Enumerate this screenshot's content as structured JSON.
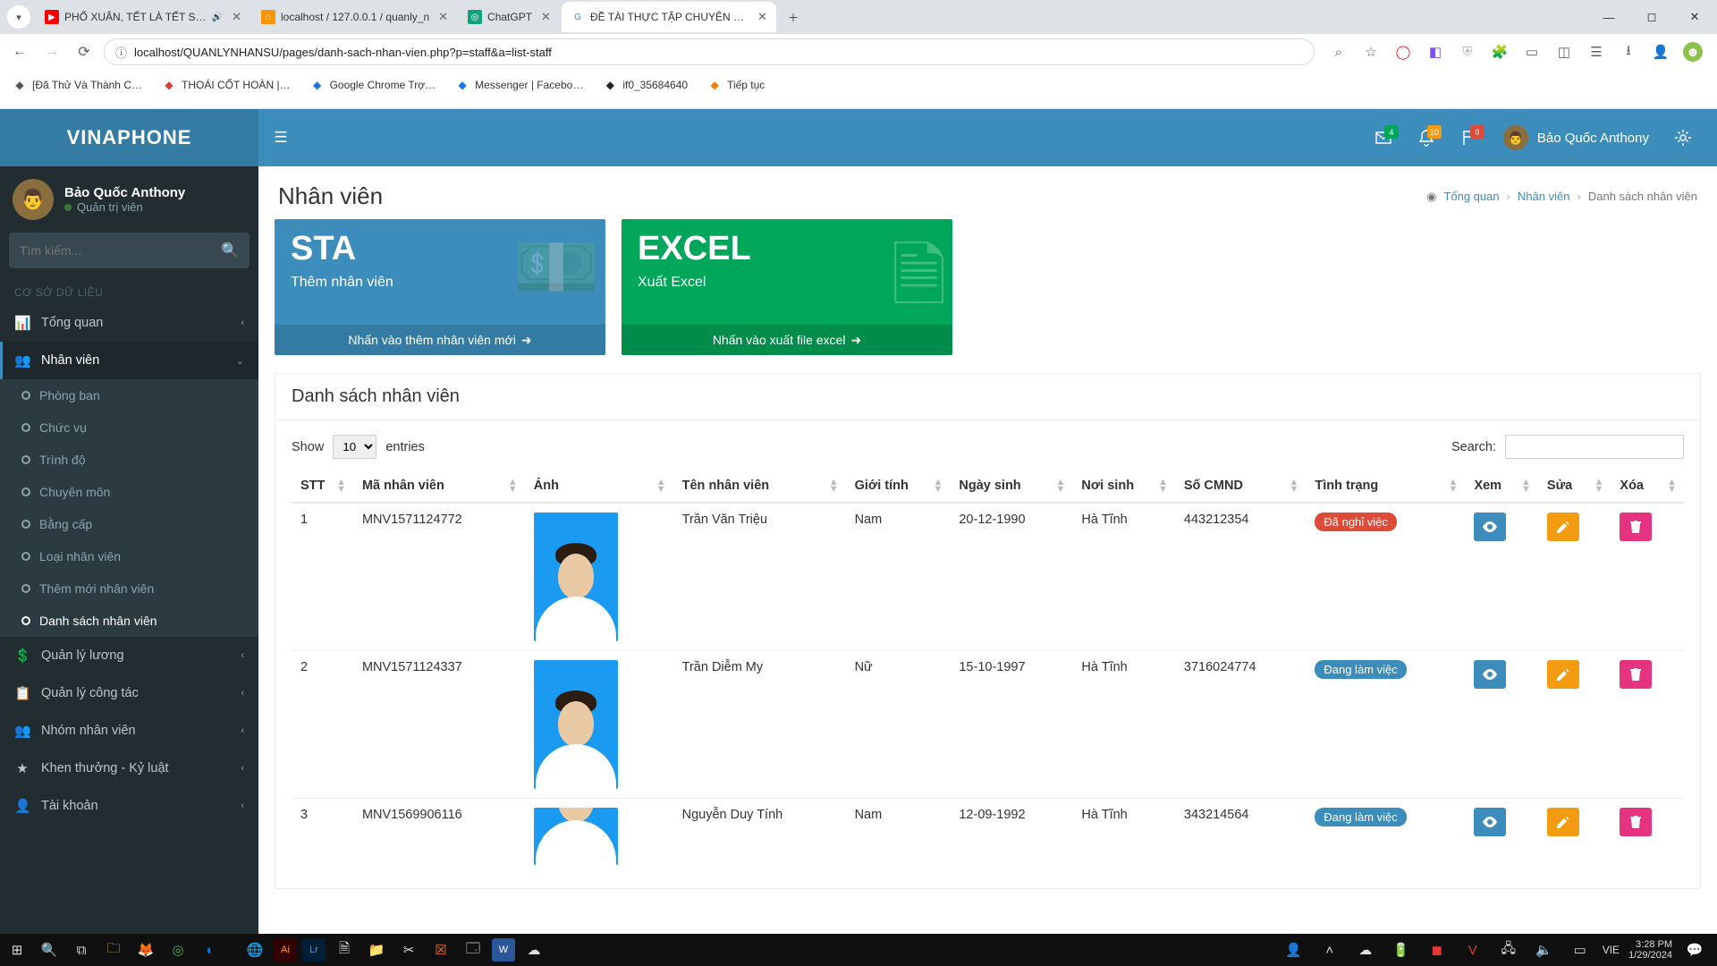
{
  "browser": {
    "tabs": [
      {
        "title": "PHỐ XUÂN, TẾT LÀ TẾT SU…",
        "fav_bg": "#ff0000",
        "fav_txt": "▶",
        "audio": true
      },
      {
        "title": "localhost / 127.0.0.1 / quanly_n",
        "fav_bg": "#f89406",
        "fav_txt": "⌂"
      },
      {
        "title": "ChatGPT",
        "fav_bg": "#10a37f",
        "fav_txt": "◎"
      },
      {
        "title": "ĐỀ TÀI THỰC TẬP CHUYÊN NG",
        "fav_bg": "#ffffff",
        "fav_txt": "G",
        "active": true
      }
    ],
    "url": "localhost/QUANLYNHANSU/pages/danh-sach-nhan-vien.php?p=staff&a=list-staff",
    "bookmarks": [
      {
        "label": "[Đã Thử Và Thành C…",
        "color": "#555"
      },
      {
        "label": "THOÁI CỐT HOÀN |…",
        "color": "#e53935"
      },
      {
        "label": "Google Chrome Trợ…",
        "color": "#1a73e8"
      },
      {
        "label": "Messenger | Facebo…",
        "color": "#1877f2"
      },
      {
        "label": "if0_35684640",
        "color": "#222"
      },
      {
        "label": "Tiếp tục",
        "color": "#f57c00"
      }
    ]
  },
  "app": {
    "brand": "VINAPHONE",
    "user": {
      "name": "Bảo Quốc Anthony",
      "role": "Quản trị viên"
    },
    "search_placeholder": "Tìm kiếm...",
    "section_header": "CƠ SỞ DỮ LIỆU",
    "nav": [
      {
        "label": "Tổng quan",
        "icon": "📊",
        "expand": true
      },
      {
        "label": "Nhân viên",
        "icon": "👥",
        "expand": true,
        "open": true,
        "sub": [
          {
            "label": "Phòng ban"
          },
          {
            "label": "Chức vụ"
          },
          {
            "label": "Trình độ"
          },
          {
            "label": "Chuyên môn"
          },
          {
            "label": "Bằng cấp"
          },
          {
            "label": "Loại nhân viên"
          },
          {
            "label": "Thêm mới nhân viên"
          },
          {
            "label": "Danh sách nhân viên",
            "sel": true
          }
        ]
      },
      {
        "label": "Quản lý lương",
        "icon": "💲",
        "expand": true
      },
      {
        "label": "Quản lý công tác",
        "icon": "📋",
        "expand": true
      },
      {
        "label": "Nhóm nhân viên",
        "icon": "👥",
        "expand": true
      },
      {
        "label": "Khen thưởng - Kỷ luật",
        "icon": "★",
        "expand": true
      },
      {
        "label": "Tài khoản",
        "icon": "👤",
        "expand": true
      }
    ],
    "topbar": {
      "badges": {
        "mail": "4",
        "bell": "10",
        "flag": "9"
      },
      "user": "Bảo Quốc Anthony"
    },
    "page_title": "Nhân viên",
    "breadcrumb": {
      "root": "Tổng quan",
      "mid": "Nhân viên",
      "leaf": "Danh sách nhân viên"
    },
    "cards": {
      "sta": {
        "title": "STA",
        "sub": "Thêm nhân viên",
        "foot": "Nhấn vào thêm nhân viên mới"
      },
      "excel": {
        "title": "EXCEL",
        "sub": "Xuất Excel",
        "foot": "Nhấn vào xuất file excel"
      }
    },
    "table": {
      "title": "Danh sách nhân viên",
      "show_label": "Show",
      "entries_label": "entries",
      "length_value": "10",
      "search_label": "Search:",
      "headers": [
        "STT",
        "Mã nhân viên",
        "Ảnh",
        "Tên nhân viên",
        "Giới tính",
        "Ngày sinh",
        "Nơi sinh",
        "Số CMND",
        "Tình trạng",
        "Xem",
        "Sửa",
        "Xóa"
      ],
      "rows": [
        {
          "stt": "1",
          "ma": "MNV1571124772",
          "ten": "Trần Văn Triệu",
          "gt": "Nam",
          "ns": "20-12-1990",
          "noi": "Hà Tĩnh",
          "cmnd": "443212354",
          "status": "Đã nghỉ việc",
          "status_cls": "pill-red"
        },
        {
          "stt": "2",
          "ma": "MNV1571124337",
          "ten": "Trần Diễm My",
          "gt": "Nữ",
          "ns": "15-10-1997",
          "noi": "Hà Tĩnh",
          "cmnd": "3716024774",
          "status": "Đang làm việc",
          "status_cls": "pill-blue"
        },
        {
          "stt": "3",
          "ma": "MNV1569906116",
          "ten": "Nguyễn Duy Tính",
          "gt": "Nam",
          "ns": "12-09-1992",
          "noi": "Hà Tĩnh",
          "cmnd": "343214564",
          "status": "Đang làm việc",
          "status_cls": "pill-blue"
        }
      ]
    }
  },
  "taskbar": {
    "time": "3:28 PM",
    "date": "1/29/2024",
    "lang": "VIE"
  }
}
